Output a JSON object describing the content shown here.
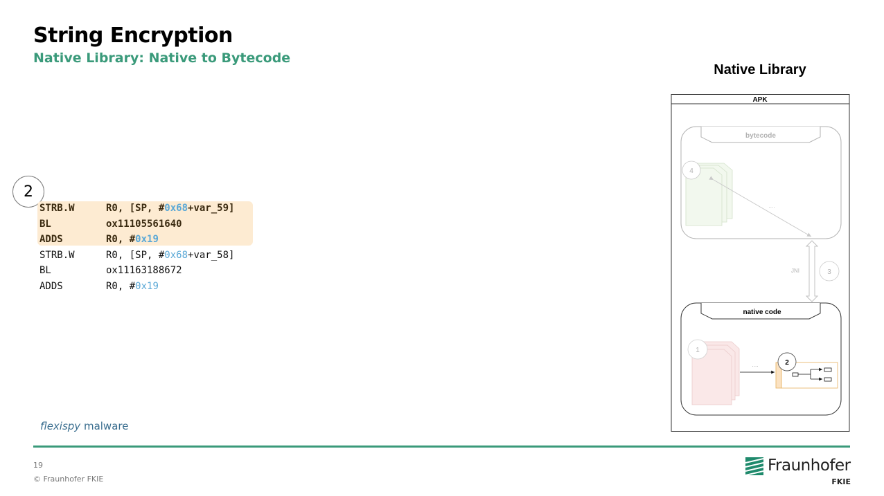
{
  "slide": {
    "title": "String Encryption",
    "subtitle": "Native Library: Native to Bytecode",
    "step_number": "2",
    "page_number": "19",
    "copyright": "© Fraunhofer FKIE",
    "footer_italic": "flexispy",
    "footer_text": " malware"
  },
  "code": {
    "lines": [
      {
        "op": "STRB.W",
        "args": [
          "R0, [SP, #",
          "0x68",
          "+var_59]"
        ],
        "highlighted": true
      },
      {
        "op": "BL",
        "args": [
          "ox11105561640"
        ],
        "highlighted": true
      },
      {
        "op": "ADDS",
        "args": [
          "R0, #",
          "0x19"
        ],
        "highlighted": true
      },
      {
        "op": "STRB.W",
        "args": [
          "R0, [SP, #",
          "0x68",
          "+var_58]"
        ],
        "highlighted": false
      },
      {
        "op": "BL",
        "args": [
          "ox11163188672"
        ],
        "highlighted": false
      },
      {
        "op": "ADDS",
        "args": [
          "R0, #",
          "0x19"
        ],
        "highlighted": false
      }
    ]
  },
  "diagram": {
    "title": "Native Library",
    "apk_label": "APK",
    "bytecode_label": "bytecode",
    "native_label": "native code",
    "jni_label": "JNI",
    "ellipsis_top": "....",
    "ellipsis_bottom": "....",
    "step_1": "1",
    "step_2": "2",
    "step_3": "3",
    "step_4": "4"
  },
  "logo": {
    "name": "Fraunhofer",
    "sub": "FKIE"
  },
  "colors": {
    "accent_green": "#3a9a7a",
    "hex_blue": "#5aa8d6",
    "highlight_bg": "#fdebd2",
    "footer_blue": "#3a6e8f"
  }
}
